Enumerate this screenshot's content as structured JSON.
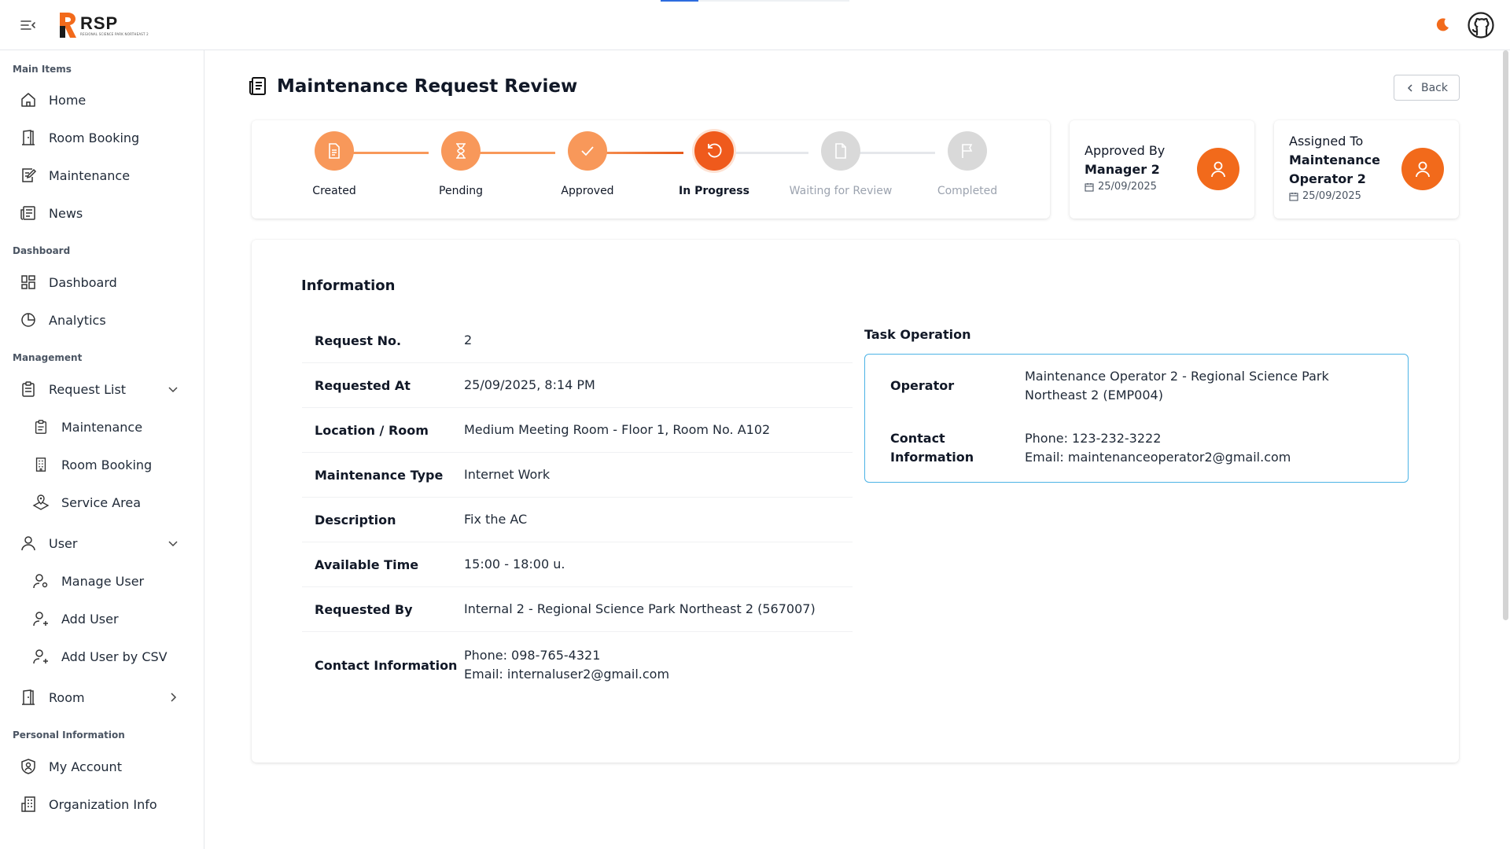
{
  "app": {
    "logo_name": "RSP",
    "logo_sub": "REGIONAL SCIENCE PARK NORTHEAST 2"
  },
  "sidebar": {
    "sections": {
      "main": "Main Items",
      "dashboard": "Dashboard",
      "management": "Management",
      "personal": "Personal Information"
    },
    "items": {
      "home": "Home",
      "room_booking": "Room Booking",
      "maintenance": "Maintenance",
      "news": "News",
      "dashboard": "Dashboard",
      "analytics": "Analytics",
      "request_list": "Request List",
      "req_maintenance": "Maintenance",
      "req_room_booking": "Room Booking",
      "req_service_area": "Service Area",
      "user": "User",
      "manage_user": "Manage User",
      "add_user": "Add User",
      "add_user_csv": "Add User by CSV",
      "room": "Room",
      "my_account": "My Account",
      "organization_info": "Organization Info"
    }
  },
  "page": {
    "title": "Maintenance Request Review",
    "back_label": "Back"
  },
  "steps": [
    {
      "label": "Created",
      "status": "done",
      "icon": "document-icon"
    },
    {
      "label": "Pending",
      "status": "done",
      "icon": "hourglass-icon"
    },
    {
      "label": "Approved",
      "status": "done",
      "icon": "check-icon"
    },
    {
      "label": "In Progress",
      "status": "current",
      "icon": "refresh-icon"
    },
    {
      "label": "Waiting for Review",
      "status": "todo",
      "icon": "file-icon"
    },
    {
      "label": "Completed",
      "status": "todo",
      "icon": "flag-icon"
    }
  ],
  "approved": {
    "title": "Approved By",
    "name": "Manager 2",
    "date": "25/09/2025"
  },
  "assigned": {
    "title": "Assigned To",
    "name_line1": "Maintenance",
    "name_line2": "Operator 2",
    "date": "25/09/2025"
  },
  "info": {
    "heading": "Information",
    "rows": [
      {
        "key": "Request No.",
        "value": "2"
      },
      {
        "key": "Requested At",
        "value": "25/09/2025, 8:14 PM"
      },
      {
        "key": "Location / Room",
        "value": "Medium Meeting Room - Floor 1, Room No. A102"
      },
      {
        "key": "Maintenance Type",
        "value": "Internet Work"
      },
      {
        "key": "Description",
        "value": "Fix the AC"
      },
      {
        "key": "Available Time",
        "value": "15:00 - 18:00 u."
      },
      {
        "key": "Requested By",
        "value": "Internal 2 - Regional Science Park Northeast 2 (567007)"
      },
      {
        "key": "Contact Information",
        "value": "Phone: 098-765-4321",
        "value2": "Email: internaluser2@gmail.com"
      }
    ]
  },
  "task": {
    "title": "Task Operation",
    "operator_key": "Operator",
    "operator_value": "Maintenance Operator 2 - Regional Science Park Northeast 2 (EMP004)",
    "contact_key": "Contact Information",
    "contact_phone": "Phone: 123-232-3222",
    "contact_email": "Email: maintenanceoperator2@gmail.com"
  },
  "colors": {
    "accent": "#f26a1b",
    "step_done": "#f8985a",
    "step_todo": "#d9d9d9",
    "task_border": "#4cb3e6"
  }
}
